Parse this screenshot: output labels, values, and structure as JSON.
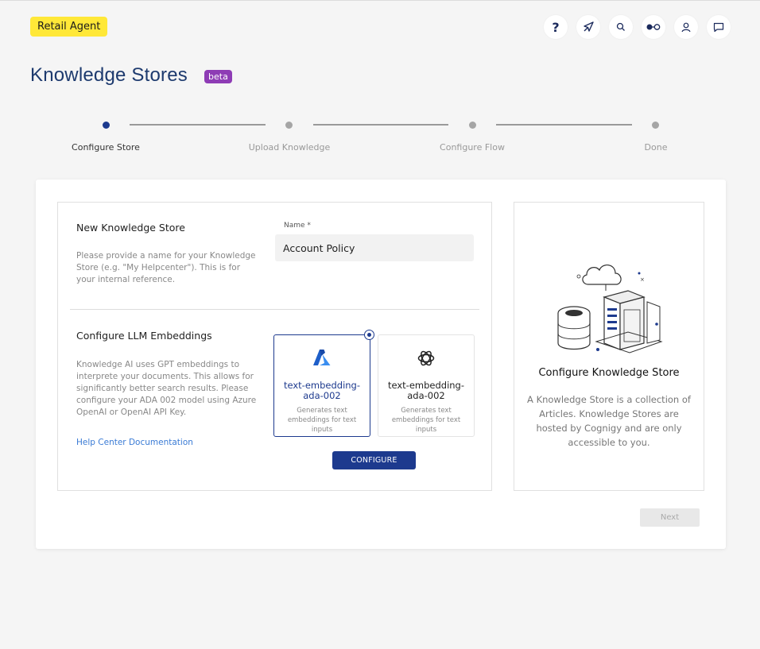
{
  "header": {
    "agent_name": "Retail Agent",
    "icons": [
      "help-icon",
      "compass-icon",
      "search-icon",
      "flow-toggle-icon",
      "user-icon",
      "chat-icon"
    ]
  },
  "page": {
    "title": "Knowledge Stores",
    "badge": "beta"
  },
  "stepper": {
    "steps": [
      {
        "label": "Configure Store",
        "active": true
      },
      {
        "label": "Upload Knowledge",
        "active": false
      },
      {
        "label": "Configure Flow",
        "active": false
      },
      {
        "label": "Done",
        "active": false
      }
    ]
  },
  "new_store": {
    "title": "New Knowledge Store",
    "description": "Please provide a name for your Knowledge Store (e.g. \"My Helpcenter\"). This is for your internal reference.",
    "name_label": "Name *",
    "name_value": "Account Policy"
  },
  "llm": {
    "title": "Configure LLM Embeddings",
    "description": "Knowledge AI uses GPT embeddings to interprete your documents. This allows for significantly better search results. Please configure your ADA 002 model using Azure OpenAI or OpenAI API Key.",
    "help_link": "Help Center Documentation",
    "options": [
      {
        "provider_icon": "azure-icon",
        "title": "text-embedding-ada-002",
        "subtitle": "Generates text embeddings for text inputs",
        "selected": true,
        "title_color": "#1d3a8e"
      },
      {
        "provider_icon": "openai-icon",
        "title": "text-embedding-ada-002",
        "subtitle": "Generates text embeddings for text inputs",
        "selected": false,
        "title_color": "#222222"
      }
    ],
    "configure_label": "CONFIGURE"
  },
  "info_panel": {
    "title": "Configure Knowledge Store",
    "description": "A Knowledge Store is a collection of Articles. Knowledge Stores are hosted by Cognigy and are only accessible to you."
  },
  "footer": {
    "next_label": "Next"
  },
  "colors": {
    "primary": "#1d3a8e",
    "agent_badge": "#ffe838",
    "beta_badge": "#8e3cb5",
    "link": "#3a7bd5"
  }
}
